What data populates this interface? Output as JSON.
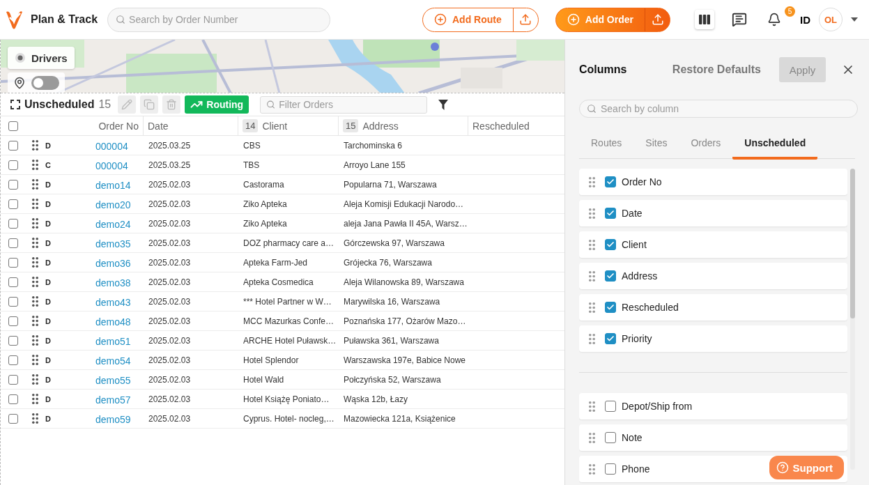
{
  "header": {
    "app_title": "Plan & Track",
    "search": {
      "placeholder": "Search by Order Number"
    },
    "add_route": "Add Route",
    "add_order": "Add Order",
    "notification_count": "5",
    "language": "ID",
    "avatar": "OL"
  },
  "map": {
    "kind": "picture",
    "drivers_label": "Drivers",
    "pin_toggle_on": false
  },
  "orders_panel": {
    "title": "Unscheduled",
    "count": "15",
    "actions": [
      {
        "kind": "edit",
        "disabled": true
      },
      {
        "kind": "copy",
        "disabled": true
      },
      {
        "kind": "delete",
        "disabled": true
      }
    ],
    "routing_button": "Routing",
    "filter": {
      "placeholder": "Filter Orders"
    },
    "select_all_checked": false,
    "columns": [
      {
        "label": "Order No"
      },
      {
        "label": "Date"
      },
      {
        "label": "Client",
        "badge": "14"
      },
      {
        "label": "Address",
        "badge": "15"
      },
      {
        "label": "Rescheduled"
      }
    ],
    "rows": [
      {
        "checked": false,
        "type": "D",
        "order_no": "000004",
        "date": "2025.03.25",
        "client": "CBS",
        "address": "Tarchominska 6"
      },
      {
        "checked": false,
        "type": "C",
        "order_no": "000004",
        "date": "2025.03.25",
        "client": "TBS",
        "address": "Arroyo Lane 155"
      },
      {
        "checked": false,
        "type": "D",
        "order_no": "demo14",
        "date": "2025.02.03",
        "client": "Castorama",
        "address": "Popularna 71, Warszawa"
      },
      {
        "checked": false,
        "type": "D",
        "order_no": "demo20",
        "date": "2025.02.03",
        "client": "Ziko Apteka",
        "address": "Aleja Komisji Edukacji Narodo…"
      },
      {
        "checked": false,
        "type": "D",
        "order_no": "demo24",
        "date": "2025.02.03",
        "client": "Ziko Apteka",
        "address": "aleja Jana Pawła II 45A, Warsz…"
      },
      {
        "checked": false,
        "type": "D",
        "order_no": "demo35",
        "date": "2025.02.03",
        "client": "DOZ pharmacy care a…",
        "address": "Górczewska 97, Warszawa"
      },
      {
        "checked": false,
        "type": "D",
        "order_no": "demo36",
        "date": "2025.02.03",
        "client": "Apteka Farm-Jed",
        "address": "Grójecka 76, Warszawa"
      },
      {
        "checked": false,
        "type": "D",
        "order_no": "demo38",
        "date": "2025.02.03",
        "client": "Apteka Cosmedica",
        "address": "Aleja Wilanowska 89, Warszawa"
      },
      {
        "checked": false,
        "type": "D",
        "order_no": "demo43",
        "date": "2025.02.03",
        "client": "*** Hotel Partner w W…",
        "address": "Marywilska 16, Warszawa"
      },
      {
        "checked": false,
        "type": "D",
        "order_no": "demo48",
        "date": "2025.02.03",
        "client": "MCC Mazurkas Confe…",
        "address": "Poznańska 177, Ożarów Mazo…"
      },
      {
        "checked": false,
        "type": "D",
        "order_no": "demo51",
        "date": "2025.02.03",
        "client": "ARCHE Hotel Puławsk…",
        "address": "Puławska 361, Warszawa"
      },
      {
        "checked": false,
        "type": "D",
        "order_no": "demo54",
        "date": "2025.02.03",
        "client": "Hotel Splendor",
        "address": "Warszawska 197e, Babice Nowe"
      },
      {
        "checked": false,
        "type": "D",
        "order_no": "demo55",
        "date": "2025.02.03",
        "client": "Hotel Wald",
        "address": "Połczyńska 52, Warszawa"
      },
      {
        "checked": false,
        "type": "D",
        "order_no": "demo57",
        "date": "2025.02.03",
        "client": "Hotel Książę Poniato…",
        "address": "Wąska 12b, Łazy"
      },
      {
        "checked": false,
        "type": "D",
        "order_no": "demo59",
        "date": "2025.02.03",
        "client": "Cyprus. Hotel- nocleg,…",
        "address": "Mazowiecka 121a, Książenice"
      }
    ]
  },
  "columns_panel": {
    "title": "Columns",
    "restore": "Restore Defaults",
    "apply": "Apply",
    "search": {
      "placeholder": "Search by column"
    },
    "tabs": [
      {
        "label": "Routes",
        "selected": false
      },
      {
        "label": "Sites",
        "selected": false
      },
      {
        "label": "Orders",
        "selected": false
      },
      {
        "label": "Unscheduled",
        "selected": true
      }
    ],
    "visible": [
      {
        "label": "Order No",
        "checked": true
      },
      {
        "label": "Date",
        "checked": true
      },
      {
        "label": "Client",
        "checked": true
      },
      {
        "label": "Address",
        "checked": true
      },
      {
        "label": "Rescheduled",
        "checked": true
      },
      {
        "label": "Priority",
        "checked": true
      }
    ],
    "hidden": [
      {
        "label": "Depot/Ship from",
        "checked": false
      },
      {
        "label": "Note",
        "checked": false
      },
      {
        "label": "Phone",
        "checked": false
      }
    ]
  },
  "support": "Support"
}
